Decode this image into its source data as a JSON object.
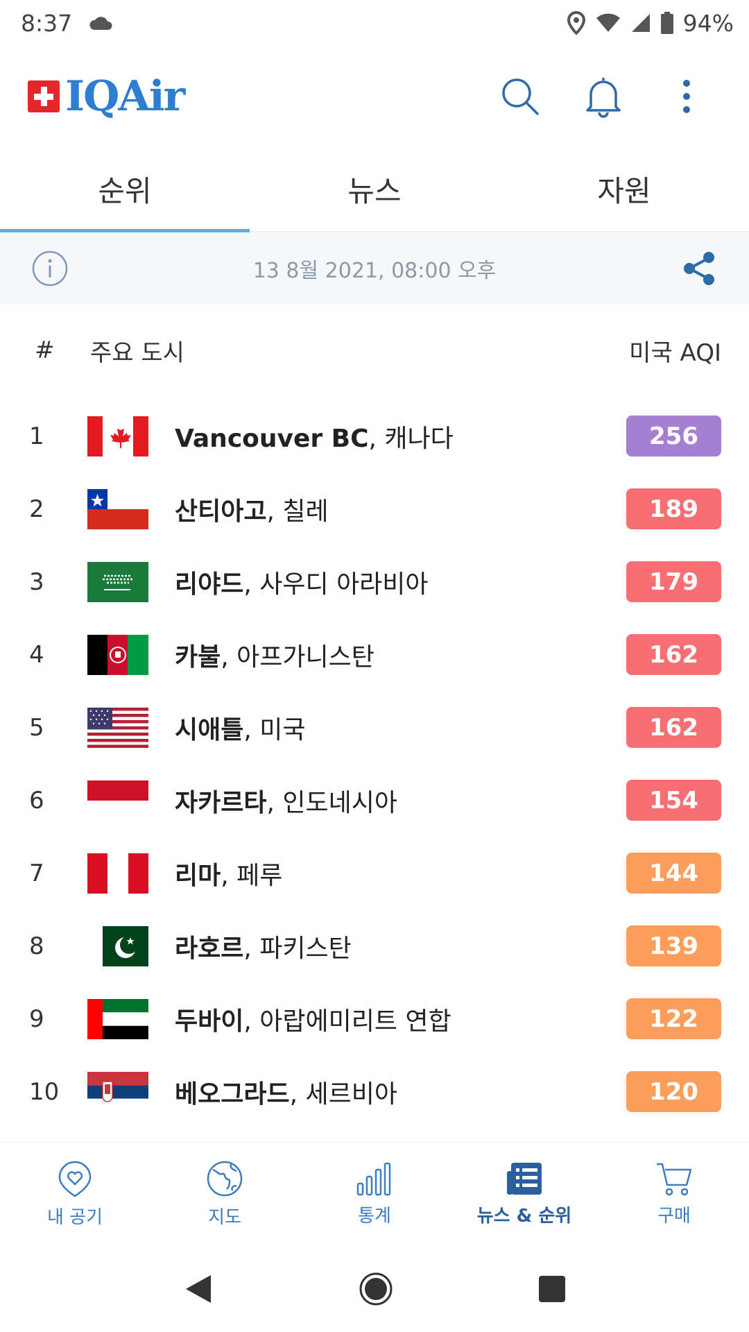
{
  "status_bar": {
    "time": "8:37",
    "battery": "94%",
    "icons": [
      "cloud-icon",
      "location-icon",
      "wifi-icon",
      "signal-icon",
      "battery-icon"
    ]
  },
  "app_bar": {
    "brand": "IQAir",
    "actions": [
      "search-icon",
      "bell-icon",
      "more-vert-icon"
    ]
  },
  "tabs": [
    {
      "label": "순위",
      "active": true
    },
    {
      "label": "뉴스",
      "active": false
    },
    {
      "label": "자원",
      "active": false
    }
  ],
  "info_bar": {
    "date": "13 8월 2021, 08:00 오후"
  },
  "list_header": {
    "rank": "#",
    "city": "주요 도시",
    "aqi": "미국 AQI"
  },
  "rankings": [
    {
      "rank": "1",
      "city": "Vancouver BC",
      "country": ", 캐나다",
      "aqi": "256",
      "level": "purple",
      "flag": "canada"
    },
    {
      "rank": "2",
      "city": "산티아고",
      "country": ", 칠레",
      "aqi": "189",
      "level": "red",
      "flag": "chile"
    },
    {
      "rank": "3",
      "city": "리야드",
      "country": ", 사우디 아라비아",
      "aqi": "179",
      "level": "red",
      "flag": "saudi"
    },
    {
      "rank": "4",
      "city": "카불",
      "country": ", 아프가니스탄",
      "aqi": "162",
      "level": "red",
      "flag": "afghanistan"
    },
    {
      "rank": "5",
      "city": "시애틀",
      "country": ", 미국",
      "aqi": "162",
      "level": "red",
      "flag": "usa"
    },
    {
      "rank": "6",
      "city": "자카르타",
      "country": ", 인도네시아",
      "aqi": "154",
      "level": "red",
      "flag": "indonesia"
    },
    {
      "rank": "7",
      "city": "리마",
      "country": ", 페루",
      "aqi": "144",
      "level": "orange",
      "flag": "peru"
    },
    {
      "rank": "8",
      "city": "라호르",
      "country": ", 파키스탄",
      "aqi": "139",
      "level": "orange",
      "flag": "pakistan"
    },
    {
      "rank": "9",
      "city": "두바이",
      "country": ", 아랍에미리트 연합",
      "aqi": "122",
      "level": "orange",
      "flag": "uae"
    },
    {
      "rank": "10",
      "city": "베오그라드",
      "country": ", 세르비아",
      "aqi": "120",
      "level": "orange",
      "flag": "serbia"
    }
  ],
  "bottom_nav": [
    {
      "label": "내 공기",
      "icon": "heart-icon",
      "active": false
    },
    {
      "label": "지도",
      "icon": "globe-icon",
      "active": false
    },
    {
      "label": "통계",
      "icon": "bar-chart-icon",
      "active": false
    },
    {
      "label": "뉴스 & 순위",
      "icon": "news-icon",
      "active": true
    },
    {
      "label": "구매",
      "icon": "cart-icon",
      "active": false
    }
  ],
  "colors": {
    "brand": "#2d7dd2",
    "tab_indicator": "#5ab4d6",
    "aqi_purple": "#a67fd3",
    "aqi_red": "#f86e72",
    "aqi_orange": "#fb9d5b"
  }
}
